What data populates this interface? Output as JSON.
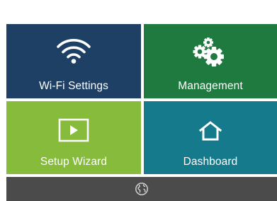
{
  "tiles": {
    "wifi": {
      "label": "Wi-Fi Settings",
      "icon": "wifi-icon",
      "color": "#1e4064"
    },
    "management": {
      "label": "Management",
      "icon": "gears-icon",
      "color": "#1f7a40"
    },
    "setup": {
      "label": "Setup Wizard",
      "icon": "play-icon",
      "color": "#86bb3c"
    },
    "dashboard": {
      "label": "Dashboard",
      "icon": "home-icon",
      "color": "#157a8c"
    }
  },
  "bottom_bar": {
    "icon": "globe-icon",
    "color": "#4b4b4b"
  }
}
